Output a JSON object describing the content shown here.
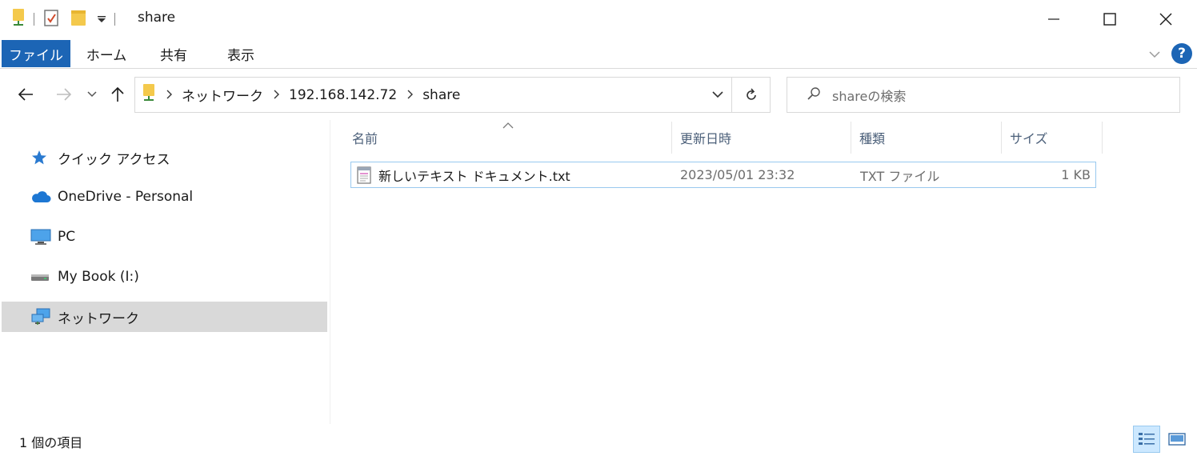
{
  "window": {
    "title": "share"
  },
  "ribbon": {
    "tabs": [
      "ファイル",
      "ホーム",
      "共有",
      "表示"
    ]
  },
  "address": {
    "crumbs": [
      "ネットワーク",
      "192.168.142.72",
      "share"
    ]
  },
  "search": {
    "placeholder": "shareの検索"
  },
  "sidebar": {
    "items": [
      {
        "label": "クイック アクセス",
        "icon": "star-icon"
      },
      {
        "label": "OneDrive - Personal",
        "icon": "cloud-icon"
      },
      {
        "label": "PC",
        "icon": "computer-icon"
      },
      {
        "label": "My Book (I:)",
        "icon": "drive-icon"
      },
      {
        "label": "ネットワーク",
        "icon": "network-icon",
        "selected": true
      }
    ]
  },
  "columns": {
    "name": "名前",
    "modified": "更新日時",
    "type": "種類",
    "size": "サイズ"
  },
  "files": [
    {
      "name": "新しいテキスト ドキュメント.txt",
      "modified": "2023/05/01 23:32",
      "type": "TXT ファイル",
      "size": "1 KB"
    }
  ],
  "status": {
    "count": "1 個の項目"
  },
  "colors": {
    "accent": "#1c65b5",
    "selection": "#99c9ef",
    "sidebar_selected": "#d9d9d9"
  }
}
